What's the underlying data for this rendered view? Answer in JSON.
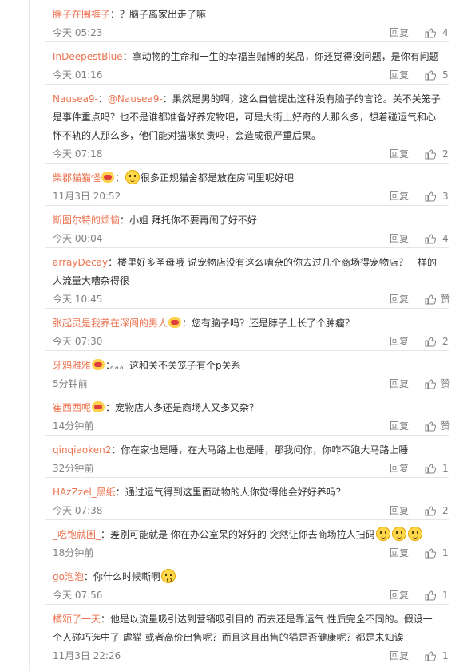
{
  "reply_label": "回复",
  "colors": {
    "username": "#eb7350",
    "meta": "#808080",
    "text": "#333333"
  },
  "comments": [
    {
      "user": "胖子在围裤子",
      "text": "：？脑子离家出走了嘛",
      "time": "今天 05:23",
      "likes": "4"
    },
    {
      "user": "InDeepestBlue",
      "text": "：拿动物的生命和一生的幸福当赌博的奖品，你还觉得没问题，是你有问题",
      "time": "今天 01:16",
      "likes": "5"
    },
    {
      "user": "Nausea9-",
      "mention": "@Nausea9-",
      "text": "：果然是男的啊，这么自信提出这种没有脑子的言论。关不关笼子是事件重点吗？也不是谁都准备好养宠物吧，可是大街上好奇的人那么多，想着碰运气和心怀不轨的人那么多，他们能对猫咪负责吗，会造成很严重后果。",
      "time": "今天 07:18",
      "likes": "2"
    },
    {
      "user": "柴郡猫猫怪",
      "text": "很多正规猫舍都是放在房间里呢好吧",
      "time": "11月3日 20:52",
      "likes": "3"
    },
    {
      "user": "斯图尔特的烦恼",
      "text": "：小姐 拜托你不要再闹了好不好",
      "time": "今天 00:04",
      "likes": "4"
    },
    {
      "user": "arrayDecay",
      "text": "：楼里好多圣母哦 说宠物店没有这么嘈杂的你去过几个商场得宠物店？一样的人流量大嘈杂得很",
      "time": "今天 10:45",
      "likes": "赞"
    },
    {
      "user": "张起灵是我养在深阁的男人",
      "text": "：您有脑子吗？还是脖子上长了个肿瘤？",
      "time": "今天 07:30",
      "likes": "2"
    },
    {
      "user": "牙鸦雅雅",
      "text": "：。。。这和关不关笼子有个p关系",
      "time": "5分钟前",
      "likes": "赞"
    },
    {
      "user": "崔西西呢",
      "text": "：宠物店人多还是商场人又多又杂？",
      "time": "14分钟前",
      "likes": "赞"
    },
    {
      "user": "qinqiaoken2",
      "text": "：你在家也是睡，在大马路上也是睡，那我问你，你咋不跑大马路上睡",
      "time": "32分钟前",
      "likes": "1"
    },
    {
      "user": "HAzZzel_黑紙",
      "text": "：通过运气得到这里面动物的人你觉得他会好好养吗？",
      "time": "今天 07:38",
      "likes": "2"
    },
    {
      "user": "_吃饱就困_",
      "text": "：差别可能就是 你在办公室呆的好好的 突然让你去商场拉人扫码",
      "time": "18分钟前",
      "likes": "1"
    },
    {
      "user": "go泡泡",
      "text": "：你什么时候嘶啊",
      "time": "今天 07:56",
      "likes": "1"
    },
    {
      "user": "橘颂了一天",
      "text": "：他是以流量吸引达到营销吸引目的 而去还是靠运气 性质完全不同的。假设一个人碰巧选中了 虐猫 或者高价出售呢？而且这且出售的猫是否健康呢？都是未知诶",
      "time": "11月3日 22:26",
      "likes": "1"
    }
  ]
}
